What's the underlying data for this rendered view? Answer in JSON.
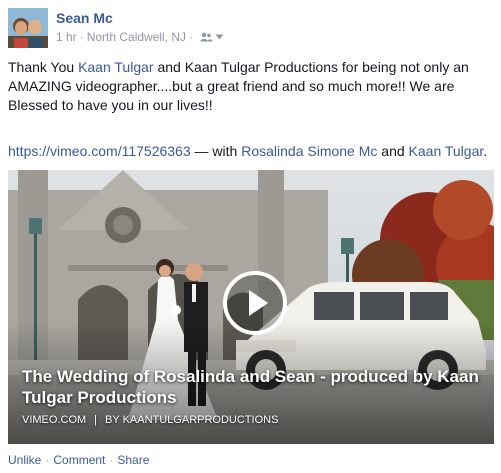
{
  "post": {
    "author": "Sean Mc",
    "time": "1 hr",
    "separator": "·",
    "location": "North Caldwell, NJ",
    "audience_icon": "friends-icon",
    "message": {
      "p1": "Thank You ",
      "link1": "Kaan Tulgar",
      "p2": " and Kaan Tulgar Productions for being not only an AMAZING videographer....but a great friend and so much more!! We are Blessed to have you in our lives!!"
    },
    "share_line": {
      "url": "https://vimeo.com/117526363",
      "with_text": " — with ",
      "tag1": "Rosalinda Simone Mc",
      "and_text": " and ",
      "tag2": "Kaan Tulgar",
      "end": "."
    },
    "video": {
      "title": "The Wedding of Rosalinda and Sean - produced by Kaan Tulgar Productions",
      "source": "VIMEO.COM",
      "divider": "|",
      "by": "BY KAANTULGARPRODUCTIONS",
      "play_icon": "play-icon"
    },
    "actions": {
      "unlike": "Unlike",
      "comment": "Comment",
      "share": "Share",
      "dot": "·"
    }
  },
  "colors": {
    "link": "#3b5998",
    "meta": "#9197a3",
    "text": "#141823"
  }
}
